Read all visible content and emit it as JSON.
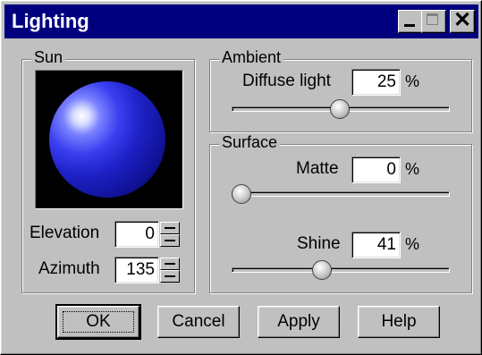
{
  "window": {
    "title": "Lighting"
  },
  "sun": {
    "legend": "Sun",
    "elevation_label": "Elevation",
    "elevation_value": "0",
    "azimuth_label": "Azimuth",
    "azimuth_value": "135"
  },
  "ambient": {
    "legend": "Ambient",
    "diffuse_label": "Diffuse light",
    "diffuse_value": "25",
    "diffuse_unit": "%",
    "diffuse_slider_fraction": 0.5
  },
  "surface": {
    "legend": "Surface",
    "matte_label": "Matte",
    "matte_value": "0",
    "matte_unit": "%",
    "matte_slider_fraction": 0.0,
    "shine_label": "Shine",
    "shine_value": "41",
    "shine_unit": "%",
    "shine_slider_fraction": 0.41
  },
  "buttons": {
    "ok": "OK",
    "cancel": "Cancel",
    "apply": "Apply",
    "help": "Help"
  }
}
